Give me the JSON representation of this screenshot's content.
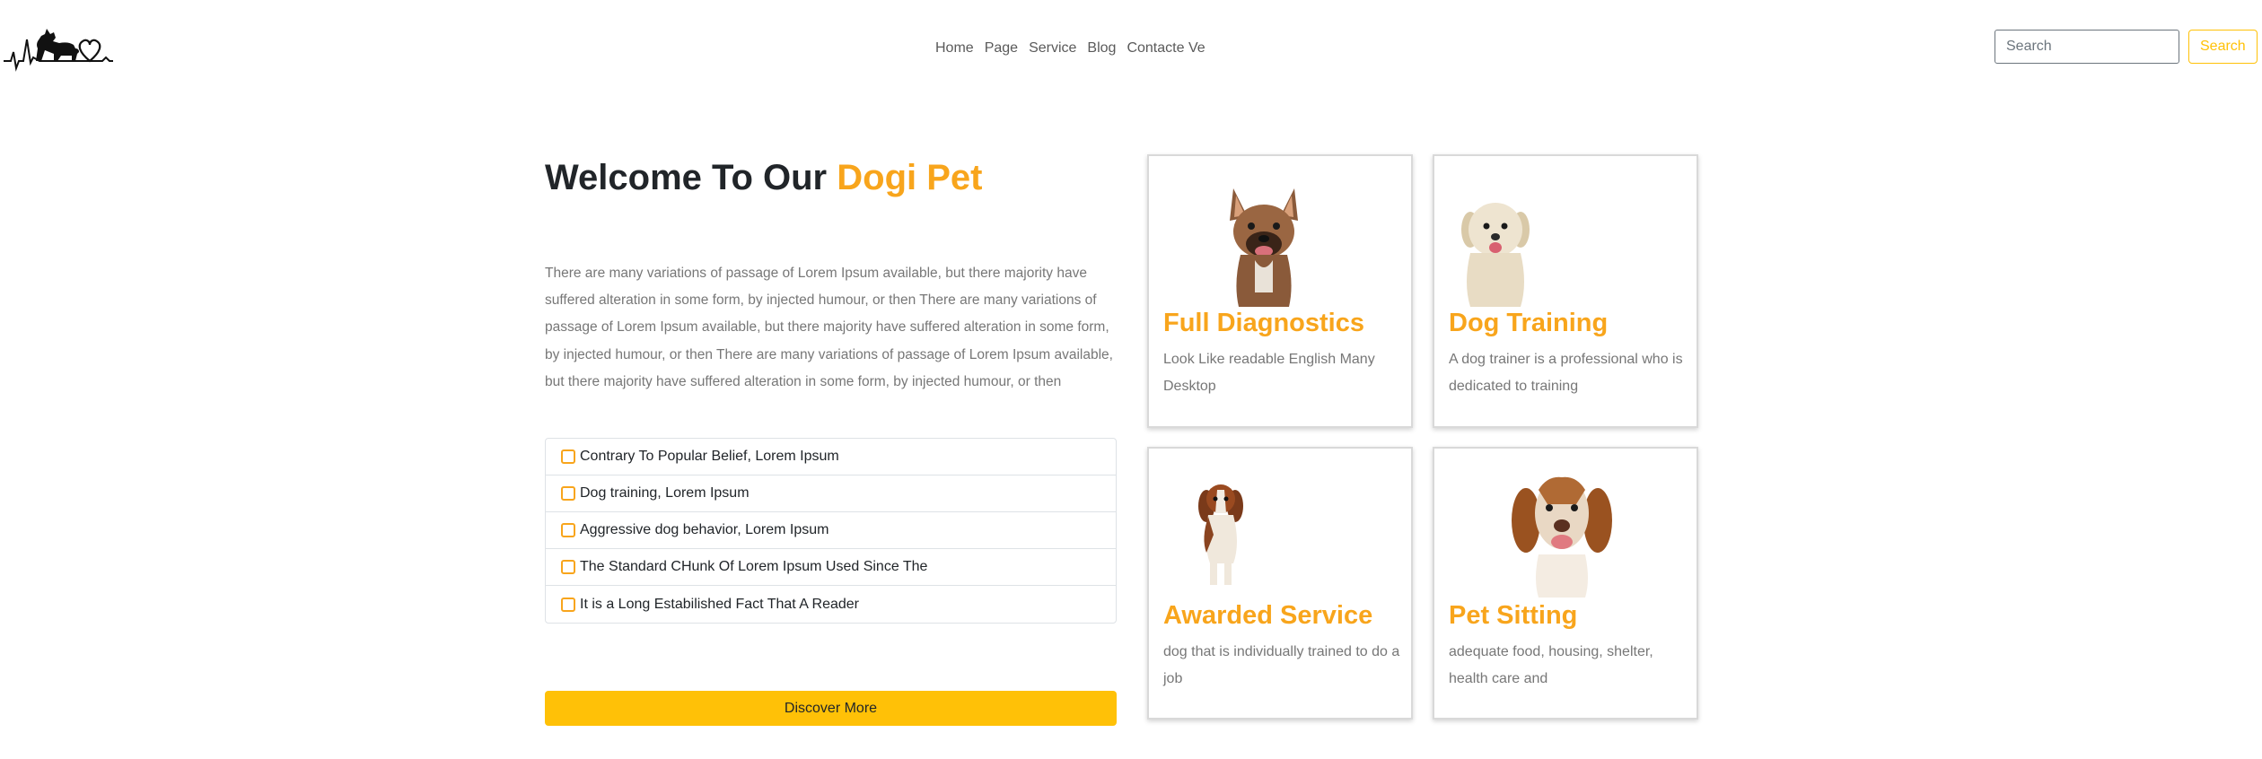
{
  "nav": {
    "links": [
      {
        "label": "Home"
      },
      {
        "label": "Page"
      },
      {
        "label": "Service"
      },
      {
        "label": "Blog"
      },
      {
        "label": "Contacte Ve"
      }
    ],
    "search": {
      "placeholder": "Search",
      "button_label": "Search"
    }
  },
  "hero": {
    "title_main": "Welcome To Our",
    "title_accent": "Dogi Pet",
    "paragraph": "There are many variations of passage of Lorem Ipsum available, but there majority have suffered alteration in some form, by injected humour, or then There are many variations of passage of Lorem Ipsum available, but there majority have suffered alteration in some form, by injected humour, or then There are many variations of passage of Lorem Ipsum available, but there majority have suffered alteration in some form, by injected humour, or then",
    "checklist": [
      {
        "label": "Contrary To Popular Belief, Lorem Ipsum"
      },
      {
        "label": "Dog training, Lorem Ipsum"
      },
      {
        "label": "Aggressive dog behavior, Lorem Ipsum"
      },
      {
        "label": "The Standard CHunk Of Lorem Ipsum Used Since The"
      },
      {
        "label": "It is a Long Estabilished Fact That A Reader"
      }
    ],
    "discover_label": "Discover More"
  },
  "cards": [
    {
      "title": "Full Diagnostics",
      "text": "Look Like readable English Many Desktop",
      "icon": "french-bulldog-photo"
    },
    {
      "title": "Dog Training",
      "text": "A dog trainer is a professional who is dedicated to training",
      "icon": "fluffy-dog-photo"
    },
    {
      "title": "Awarded Service",
      "text": "dog that is individually trained to do a job",
      "icon": "spaniel-puppy-photo"
    },
    {
      "title": "Pet Sitting",
      "text": "adequate food, housing, shelter, health care and",
      "icon": "beagle-photo"
    }
  ],
  "colors": {
    "accent": "#f8a51c",
    "button": "#ffc107",
    "text_muted": "#777777"
  }
}
